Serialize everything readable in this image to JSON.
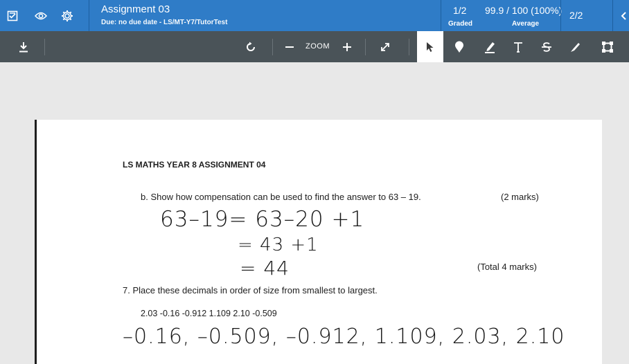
{
  "header": {
    "title": "Assignment 03",
    "subtitle": "Due: no due date - LS/MT-Y7/TutorTest",
    "graded_value": "1/2",
    "graded_label": "Graded",
    "average_value": "99.9 / 100 (100%)",
    "average_label": "Average",
    "pages": "2/2"
  },
  "toolbar": {
    "zoom_label": "ZOOM"
  },
  "document": {
    "heading": "LS MATHS YEAR 8 ASSIGNMENT 04",
    "question_b": "b.   Show how compensation can be used to find the answer to  63 – 19.",
    "question_b_marks": "(2 marks)",
    "answer_line1": "63–19= 63–20 +1",
    "answer_line2": "= 43 +1",
    "answer_line3": "= 44",
    "total_marks": "(Total 4 marks)",
    "question_7": "7.   Place these decimals in order of size from smallest to largest.",
    "decimals": "2.03  -0.16  -0.912  1.109  2.10  -0.509",
    "answer_7": "–0.16, –0.509, –0.912, 1.109, 2.03, 2.10"
  },
  "colors": {
    "topbar": "#2f7cc7",
    "toolbar": "#4a5358",
    "background": "#e8e8e8"
  },
  "icons": [
    "submissions-icon",
    "eye-icon",
    "gear-icon",
    "download-icon",
    "rotate-icon",
    "minus-icon",
    "plus-icon",
    "expand-icon",
    "pointer-icon",
    "pin-icon",
    "highlighter-icon",
    "text-icon",
    "strikethrough-icon",
    "pen-icon",
    "crop-icon",
    "prev-icon"
  ]
}
